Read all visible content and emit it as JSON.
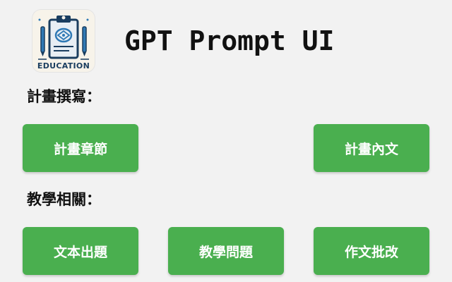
{
  "app": {
    "title": "GPT Prompt UI",
    "logo_text": "EDUCATION"
  },
  "sections": [
    {
      "title": "計畫撰寫：",
      "buttons": [
        "計畫章節",
        "計畫內文"
      ]
    },
    {
      "title": "教學相關：",
      "buttons": [
        "文本出題",
        "教學問題",
        "作文批改"
      ]
    }
  ],
  "colors": {
    "background": "#f2f2f2",
    "button": "#4aaf4f",
    "button_text": "#ffffff",
    "logo_accent": "#1a3d5f"
  },
  "icons": {
    "logo": "education-clipboard-icon"
  }
}
